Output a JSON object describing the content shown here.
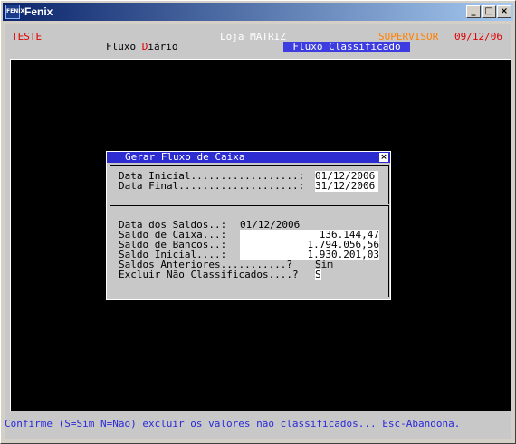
{
  "window": {
    "title": "Fenix",
    "icon_label": "FENIX",
    "minimize_glyph": "_",
    "maximize_glyph": "□",
    "close_glyph": "×"
  },
  "header": {
    "company": "TESTE",
    "store": "Loja MATRIZ",
    "user": "SUPERVISOR",
    "date": "09/12/06",
    "menu_fluxo_prefix": "Fluxo ",
    "menu_fluxo_hotkey": "D",
    "menu_fluxo_suffix": "iário",
    "menu_classificado": "Fluxo Classificado"
  },
  "dialog": {
    "title": "Gerar Fluxo de Caixa",
    "close_glyph": "×",
    "data_inicial_label": "Data Inicial..................:",
    "data_inicial_value": "01/12/2006",
    "data_final_label": "Data Final....................:",
    "data_final_value": "31/12/2006",
    "data_saldos_label": "Data dos Saldos..:",
    "data_saldos_value": "01/12/2006",
    "saldo_caixa_label": "Saldo de Caixa...:",
    "saldo_caixa_value": "136.144,47",
    "saldo_bancos_label": "Saldo de Bancos..:",
    "saldo_bancos_value": "1.794.056,56",
    "saldo_inicial_label": "Saldo Inicial....:",
    "saldo_inicial_value": "1.930.201,03",
    "saldos_anteriores_label": "Saldos Anteriores...........?",
    "saldos_anteriores_value": "Sim",
    "excluir_label": "Excluir Não Classificados....?",
    "excluir_value": "S"
  },
  "status_line": "Confirme (S=Sim N=Não) excluir os valores não classificados... Esc-Abandona.",
  "colors": {
    "title_bar": "#0a246a",
    "red": "#e00000",
    "orange": "#ff8000",
    "highlight": "#3c3ce0",
    "status_blue": "#2a2ad8"
  }
}
